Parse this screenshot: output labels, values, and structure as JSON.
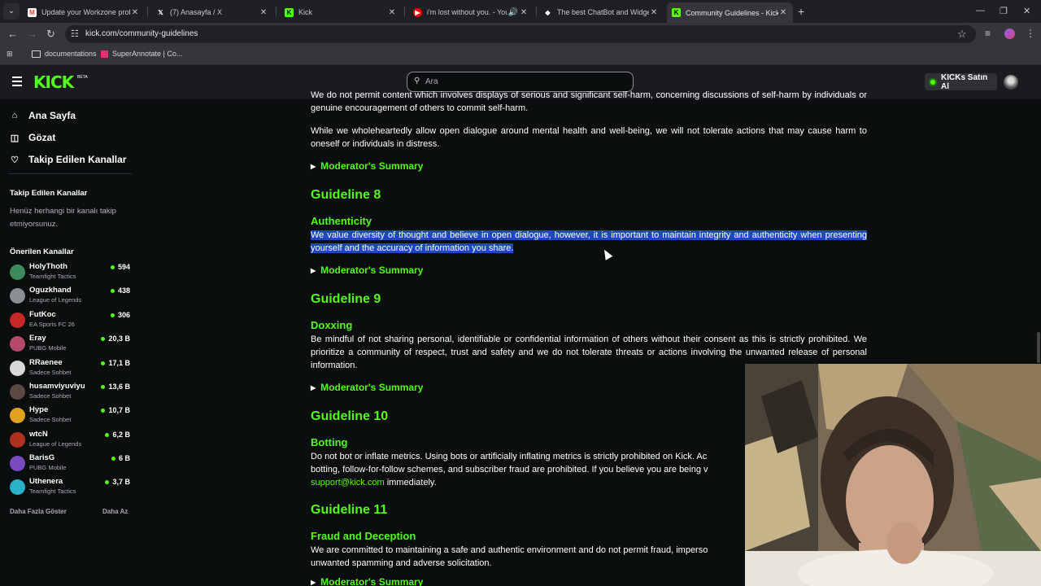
{
  "browser": {
    "tabs": [
      {
        "title": "Update your Workzone profile",
        "icon": "gmail-icon",
        "color": "#ea4335"
      },
      {
        "title": "(7) Anasayfa / X",
        "icon": "x-icon",
        "color": "#ffffff"
      },
      {
        "title": "Kick",
        "icon": "kick-icon",
        "color": "#53fc18"
      },
      {
        "title": "i'm lost without you. - YouT",
        "icon": "youtube-icon",
        "color": "#ff0000"
      },
      {
        "title": "The best ChatBot and Widgets",
        "icon": "chatbot-icon",
        "color": "#ffffff"
      },
      {
        "title": "Community Guidelines - Kick St",
        "icon": "kick-icon",
        "color": "#53fc18"
      }
    ],
    "url": "kick.com/community-guidelines",
    "bookmarks": [
      {
        "label": "documentations",
        "icon": "folder-icon"
      },
      {
        "label": "SuperAnnotate | Co...",
        "icon": "superannotate-icon"
      }
    ]
  },
  "header": {
    "logo": "KICK",
    "logo_badge": "BETA",
    "search_placeholder": "Ara",
    "buy_button": "KICKs Satın Al"
  },
  "sidebar": {
    "nav": [
      {
        "label": "Ana Sayfa",
        "icon": "home-icon"
      },
      {
        "label": "Gözat",
        "icon": "compass-icon"
      },
      {
        "label": "Takip Edilen Kanallar",
        "icon": "heart-icon"
      }
    ],
    "followed_title": "Takip Edilen Kanallar",
    "followed_empty": "Henüz herhangi bir kanalı takip etmiyorsunuz.",
    "recommended_title": "Önerilen Kanallar",
    "channels": [
      {
        "name": "HolyThoth",
        "category": "Teamfight Tactics",
        "viewers": "594",
        "avatar_color": "#3b8c5a"
      },
      {
        "name": "Oguzkhand",
        "category": "League of Legends",
        "viewers": "438",
        "avatar_color": "#8a8f96"
      },
      {
        "name": "FutKoc",
        "category": "EA Sports FC 26",
        "viewers": "306",
        "avatar_color": "#c62828"
      },
      {
        "name": "Eray",
        "category": "PUBG Mobile",
        "viewers": "20,3 B",
        "avatar_color": "#b34a6a"
      },
      {
        "name": "RRaenee",
        "category": "Sadece Sohbet",
        "viewers": "17,1 B",
        "avatar_color": "#d8d8d8"
      },
      {
        "name": "husamviyuviyu",
        "category": "Sadece Sohbet",
        "viewers": "13,6 B",
        "avatar_color": "#5a4a42"
      },
      {
        "name": "Hype",
        "category": "Sadece Sohbet",
        "viewers": "10,7 B",
        "avatar_color": "#e0a020"
      },
      {
        "name": "wtcN",
        "category": "League of Legends",
        "viewers": "6,2 B",
        "avatar_color": "#b03020"
      },
      {
        "name": "BarisG",
        "category": "PUBG Mobile",
        "viewers": "6 B",
        "avatar_color": "#7a4ac0"
      },
      {
        "name": "Uthenera",
        "category": "Teamfight Tactics",
        "viewers": "3,7 B",
        "avatar_color": "#2ab0c8"
      }
    ],
    "show_more": "Daha Fazla Göster",
    "show_less": "Daha Az"
  },
  "content": {
    "top_para_1": "We do not permit content which involves displays of serious and significant self-harm, concerning discussions of self-harm by individuals or genuine encouragement of others to commit self-harm.",
    "top_para_2": "While we wholeheartedly allow open dialogue around mental health and well-being, we will not tolerate actions that may cause harm to oneself or individuals in distress.",
    "moderator_summary": "Moderator's Summary",
    "g8_title": "Guideline 8",
    "g8_sub": "Authenticity",
    "g8_text": "We value diversity of thought and believe in open dialogue, however, it is important to maintain integrity and authenticity when presenting yourself and the accuracy of information you share.",
    "g9_title": "Guideline 9",
    "g9_sub": "Doxxing",
    "g9_text": "Be mindful of not sharing personal, identifiable or confidential information of others without their consent as this is strictly prohibited. We prioritize a community of respect, trust and safety and we do not tolerate threats or actions involving the unwanted release of personal information.",
    "g10_title": "Guideline 10",
    "g10_sub": "Botting",
    "g10_line1": "Do not bot or inflate metrics. Using bots or artificially inflating metrics is strictly prohibited on Kick. Ac",
    "g10_line2": "botting, follow-for-follow schemes, and subscriber fraud are prohibited. If you believe you are being v",
    "g10_link": "support@kick.com",
    "g10_line3_rest": " immediately.",
    "g11_title": "Guideline 11",
    "g11_sub": "Fraud and Deception",
    "g11_line1": "We are committed to maintaining a safe and authentic environment and do not permit fraud, imperso",
    "g11_line2": "unwanted spamming and adverse solicitation."
  }
}
